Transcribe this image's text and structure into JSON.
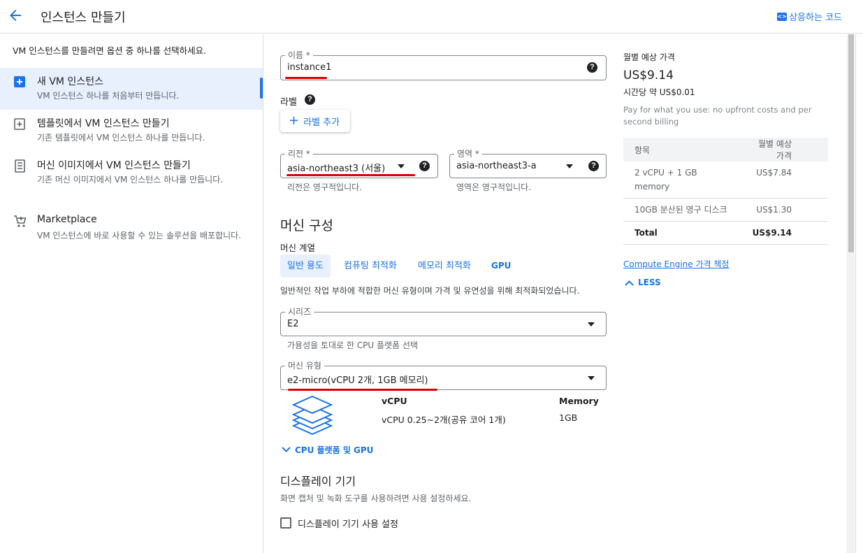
{
  "header": {
    "title": "인스턴스 만들기",
    "equivalent_code": "상응하는 코드"
  },
  "left": {
    "intro": "VM 인스턴스를 만들려면 옵션 중 하나를 선택하세요.",
    "options": [
      {
        "title": "새 VM 인스턴스",
        "desc": "VM 인스턴스 하나를 처음부터 만듭니다."
      },
      {
        "title": "템플릿에서 VM 인스턴스 만들기",
        "desc": "기존 템플릿에서 VM 인스턴스 하나를 만듭니다."
      },
      {
        "title": "머신 이미지에서 VM 인스턴스 만들기",
        "desc": "기존 머신 이미지에서 VM 인스턴스 하나를 만듭니다."
      },
      {
        "title": "Marketplace",
        "desc": "VM 인스턴스에 바로 사용할 수 있는 솔루션을 배포합니다."
      }
    ]
  },
  "form": {
    "name_label": "이름 *",
    "name_value": "instance1",
    "labels_heading": "라벨",
    "add_label": "라벨 추가",
    "region_label": "리전 *",
    "region_value": "asia-northeast3 (서울)",
    "region_hint": "리전은 영구적입니다.",
    "zone_label": "영역 *",
    "zone_value": "asia-northeast3-a",
    "zone_hint": "영역은 영구적입니다.",
    "machine_config": "머신 구성",
    "machine_family": "머신 계열",
    "tabs": [
      "일반 용도",
      "컴퓨팅 최적화",
      "메모리 최적화",
      "GPU"
    ],
    "family_desc": "일반적인 작업 부하에 적합한 머신 유형이며 가격 및 유연성을 위해 최적화되었습니다.",
    "series_label": "시리즈",
    "series_value": "E2",
    "series_hint": "가용성을 토대로 한 CPU 플랫폼 선택",
    "machine_type_label": "머신 유형",
    "machine_type_value": "e2-micro(vCPU 2개, 1GB 메모리)",
    "vcpu_heading": "vCPU",
    "memory_heading": "Memory",
    "vcpu_value": "vCPU 0.25~2개(공유 코어 1개)",
    "memory_value": "1GB",
    "cpu_platform_link": "CPU 플랫폼 및 GPU",
    "display_heading": "디스플레이 기기",
    "display_desc": "화면 캡처 및 녹화 도구를 사용하려면 사용 설정하세요.",
    "display_checkbox": "디스플레이 기기 사용 설정"
  },
  "pricing": {
    "heading": "월별 예상 가격",
    "monthly": "US$9.14",
    "hourly": "시간당 약 US$0.01",
    "note": "Pay for what you use: no upfront costs and per second billing",
    "col_item": "항목",
    "col_price": "월별 예상 가격",
    "rows": [
      {
        "item": "2 vCPU + 1 GB memory",
        "price": "US$7.84"
      },
      {
        "item": "10GB 분산된 영구 디스크",
        "price": "US$1.30"
      }
    ],
    "total_label": "Total",
    "total_value": "US$9.14",
    "pricing_link": "Compute Engine 가격 책정",
    "less": "LESS"
  },
  "colors": {
    "accent": "#1a73e8",
    "annotation": "#dd0000"
  }
}
